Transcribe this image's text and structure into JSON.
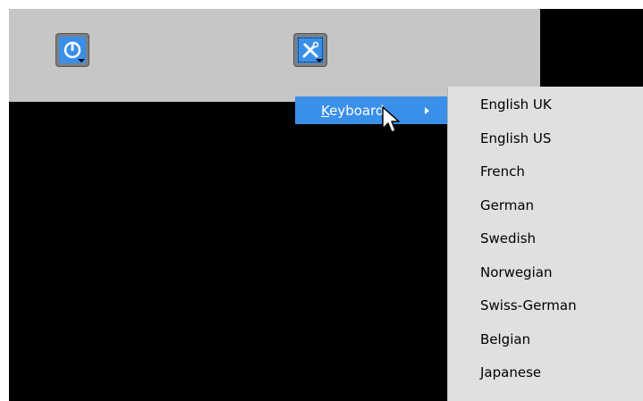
{
  "toolbar": {
    "power_button_icon": "power-icon",
    "tools_button_icon": "tools-icon"
  },
  "menu": {
    "keyboard_label": "Keyboard",
    "keyboard_mnemonic": "K"
  },
  "submenu": {
    "items": [
      "English UK",
      "English US",
      "French",
      "German",
      "Swedish",
      "Norwegian",
      "Swiss-German",
      "Belgian",
      "Japanese"
    ]
  },
  "colors": {
    "accent": "#3a8fe8",
    "toolbar_bg": "#c6c6c6",
    "submenu_bg": "#e0e0e0",
    "screen_bg": "#000000"
  }
}
